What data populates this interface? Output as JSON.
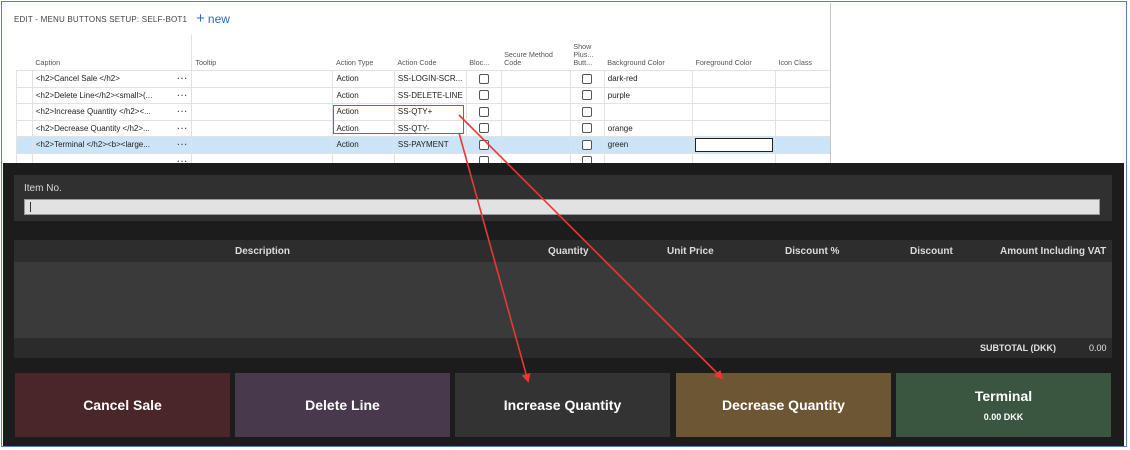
{
  "setup": {
    "title": "EDIT - MENU BUTTONS SETUP: SELF-BOT1",
    "new_label": "new",
    "columns": {
      "caption": "Caption",
      "tooltip": "Tooltip",
      "action_type": "Action Type",
      "action_code": "Action Code",
      "blocked": "Bloc...",
      "secure_method": "Secure Method Code",
      "show_plus_minus": "Show Plus... Butt...",
      "background_color": "Background Color",
      "foreground_color": "Foreground Color",
      "icon_class": "Icon Class"
    },
    "rows": [
      {
        "caption": "<h2>Cancel Sale </h2>",
        "action_type": "Action",
        "action_code": "SS-LOGIN-SCR...",
        "bg": "dark-red"
      },
      {
        "caption": "<h2>Delete Line</h2><small>(...",
        "action_type": "Action",
        "action_code": "SS-DELETE-LINE",
        "bg": "purple"
      },
      {
        "caption": "<h2>Increase Quantity </h2><...",
        "action_type": "Action",
        "action_code": "SS-QTY+",
        "bg": ""
      },
      {
        "caption": "<h2>Decrease Quantity </h2>...",
        "action_type": "Action",
        "action_code": "SS-QTY-",
        "bg": "orange"
      },
      {
        "caption": "<h2>Terminal </h2><b><large...",
        "action_type": "Action",
        "action_code": "SS-PAYMENT",
        "bg": "green"
      }
    ]
  },
  "pos": {
    "item_no_label": "Item No.",
    "columns": {
      "description": "Description",
      "quantity": "Quantity",
      "unit_price": "Unit Price",
      "discount_pct": "Discount %",
      "discount": "Discount",
      "amount_incl_vat": "Amount Including VAT"
    },
    "subtotal_label": "SUBTOTAL (DKK)",
    "subtotal_value": "0.00",
    "buttons": {
      "cancel_sale": "Cancel Sale",
      "delete_line": "Delete Line",
      "increase_quantity": "Increase Quantity",
      "decrease_quantity": "Decrease Quantity",
      "terminal": "Terminal",
      "terminal_amount": "0.00 DKK"
    }
  },
  "colors": {
    "cancel_sale": "#4a2629",
    "delete_line": "#483a4c",
    "increase_quantity": "#333333",
    "decrease_quantity": "#6c5634",
    "terminal": "#3a5540",
    "annotation": "#e53935",
    "selected_row": "#cce4f7"
  }
}
